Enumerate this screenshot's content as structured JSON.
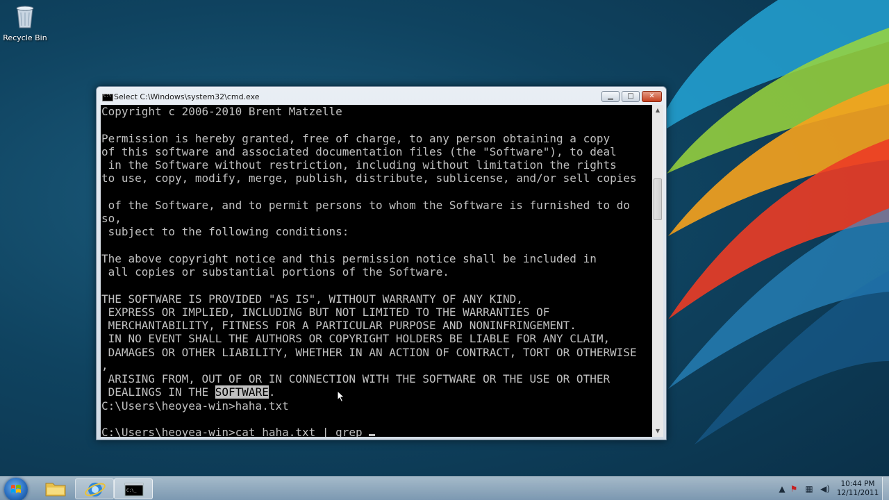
{
  "desktop": {
    "icons": [
      {
        "label": "Recycle Bin"
      }
    ]
  },
  "window": {
    "title": "Select C:\\Windows\\system32\\cmd.exe",
    "buttons": {
      "minimize": "▁",
      "maximize": "□",
      "close": "✕"
    }
  },
  "console": {
    "lines": [
      "Copyright c 2006-2010 Brent Matzelle",
      "",
      "Permission is hereby granted, free of charge, to any person obtaining a copy",
      "of this software and associated documentation files (the \"Software\"), to deal",
      " in the Software without restriction, including without limitation the rights",
      "to use, copy, modify, merge, publish, distribute, sublicense, and/or sell copies",
      "",
      " of the Software, and to permit persons to whom the Software is furnished to do",
      "so,",
      " subject to the following conditions:",
      "",
      "The above copyright notice and this permission notice shall be included in",
      " all copies or substantial portions of the Software.",
      "",
      "THE SOFTWARE IS PROVIDED \"AS IS\", WITHOUT WARRANTY OF ANY KIND,",
      " EXPRESS OR IMPLIED, INCLUDING BUT NOT LIMITED TO THE WARRANTIES OF",
      " MERCHANTABILITY, FITNESS FOR A PARTICULAR PURPOSE AND NONINFRINGEMENT.",
      " IN NO EVENT SHALL THE AUTHORS OR COPYRIGHT HOLDERS BE LIABLE FOR ANY CLAIM,",
      " DAMAGES OR OTHER LIABILITY, WHETHER IN AN ACTION OF CONTRACT, TORT OR OTHERWISE",
      ","
    ],
    "arising_line": " ARISING FROM, OUT OF OR IN CONNECTION WITH THE SOFTWARE OR THE USE OR OTHER",
    "dealings_prefix": " DEALINGS IN THE ",
    "dealings_highlight": "SOFTWARE",
    "dealings_suffix": ".",
    "prompt_line_1": "C:\\Users\\heoyea-win>haha.txt",
    "prompt_line_2": "C:\\Users\\heoyea-win>cat haha.txt | grep "
  },
  "taskbar": {
    "clock_time": "10:44 PM",
    "clock_date": "12/11/2011",
    "tray_icons": [
      "chevron-up-icon",
      "action-center-flag-icon",
      "network-icon",
      "volume-icon"
    ]
  }
}
